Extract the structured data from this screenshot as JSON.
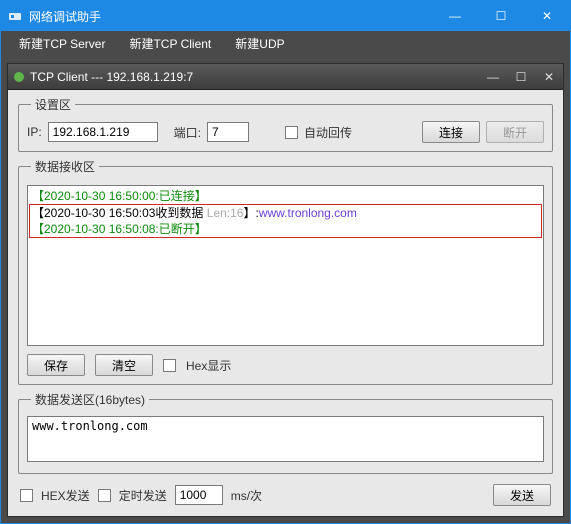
{
  "outer": {
    "title": "网络调试助手",
    "buttons": {
      "min": "—",
      "max": "☐",
      "close": "✕"
    }
  },
  "menu": {
    "new_tcp_server": "新建TCP Server",
    "new_tcp_client": "新建TCP Client",
    "new_udp": "新建UDP"
  },
  "inner": {
    "title": "TCP Client --- 192.168.1.219:7",
    "buttons": {
      "min": "—",
      "max": "☐",
      "close": "✕"
    }
  },
  "settings": {
    "legend": "设置区",
    "ip_label": "IP:",
    "ip_value": "192.168.1.219",
    "port_label": "端口:",
    "port_value": "7",
    "auto_return": "自动回传",
    "connect": "连接",
    "disconnect": "断开"
  },
  "recv": {
    "legend": "数据接收区",
    "lines": {
      "l1": "【2020-10-30 16:50:00:已连接】",
      "l2_prefix": "【2020-10-30 16:50:03收到数据 ",
      "l2_len": "Len:16",
      "l2_mid": "】:",
      "l2_payload": "www.tronlong.com",
      "l3": "【2020-10-30 16:50:08:已断开】"
    },
    "save": "保存",
    "clear": "清空",
    "hex_display": "Hex显示"
  },
  "send": {
    "legend": "数据发送区(16bytes)",
    "content": "www.tronlong.com"
  },
  "bottom": {
    "hex_send": "HEX发送",
    "timed_send": "定时发送",
    "interval": "1000",
    "unit": "ms/次",
    "send_btn": "发送"
  }
}
